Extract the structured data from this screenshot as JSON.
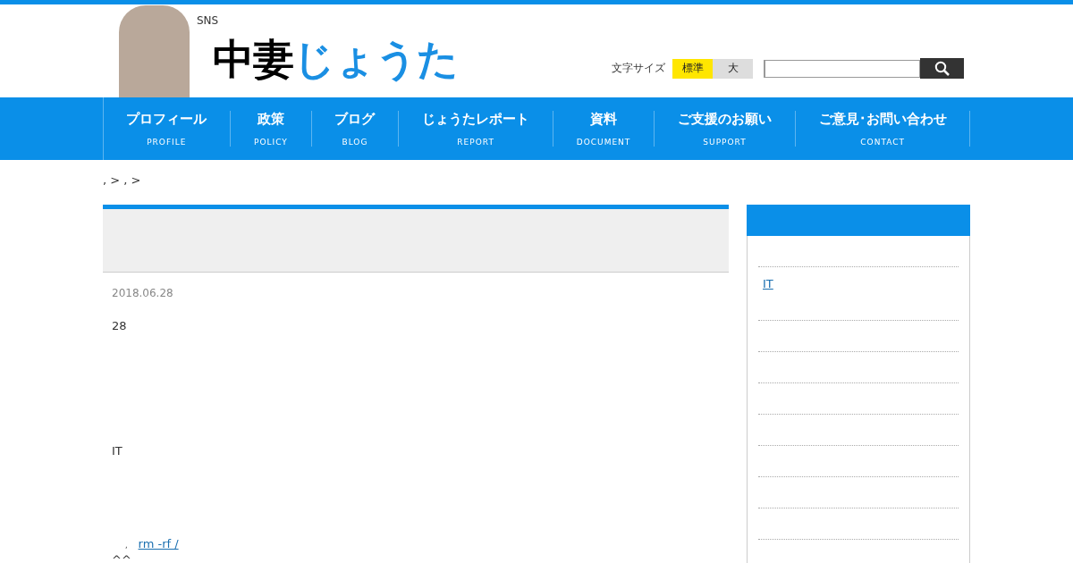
{
  "header": {
    "tagline": "SNS",
    "logo": {
      "dark": "中妻",
      "accent": "じょうた"
    },
    "font_size": {
      "label": "文字サイズ",
      "options": [
        {
          "label": "標準",
          "selected": true
        },
        {
          "label": "大",
          "selected": false
        }
      ]
    }
  },
  "nav": [
    {
      "label": "プロフィール",
      "sub": "PROFILE"
    },
    {
      "label": "政策",
      "sub": "POLICY"
    },
    {
      "label": "ブログ",
      "sub": "BLOG"
    },
    {
      "label": "じょうたレポート",
      "sub": "REPORT"
    },
    {
      "label": "資料",
      "sub": "DOCUMENT"
    },
    {
      "label": "ご支援のお願い",
      "sub": "SUPPORT"
    },
    {
      "label": "ご意見･お問い合わせ",
      "sub": "CONTACT"
    }
  ],
  "breadcrumb": ", > , >",
  "article": {
    "date": "2018.06.28",
    "paragraphs": [
      {
        "kind": "text",
        "text": "28"
      },
      {
        "kind": "text",
        "text": "IT"
      },
      {
        "kind": "link",
        "prefix": ",",
        "link": "rm -rf /"
      },
      {
        "kind": "text",
        "text": "^^"
      }
    ]
  },
  "sidebar": {
    "items": [
      {
        "label": "IT"
      }
    ]
  }
}
